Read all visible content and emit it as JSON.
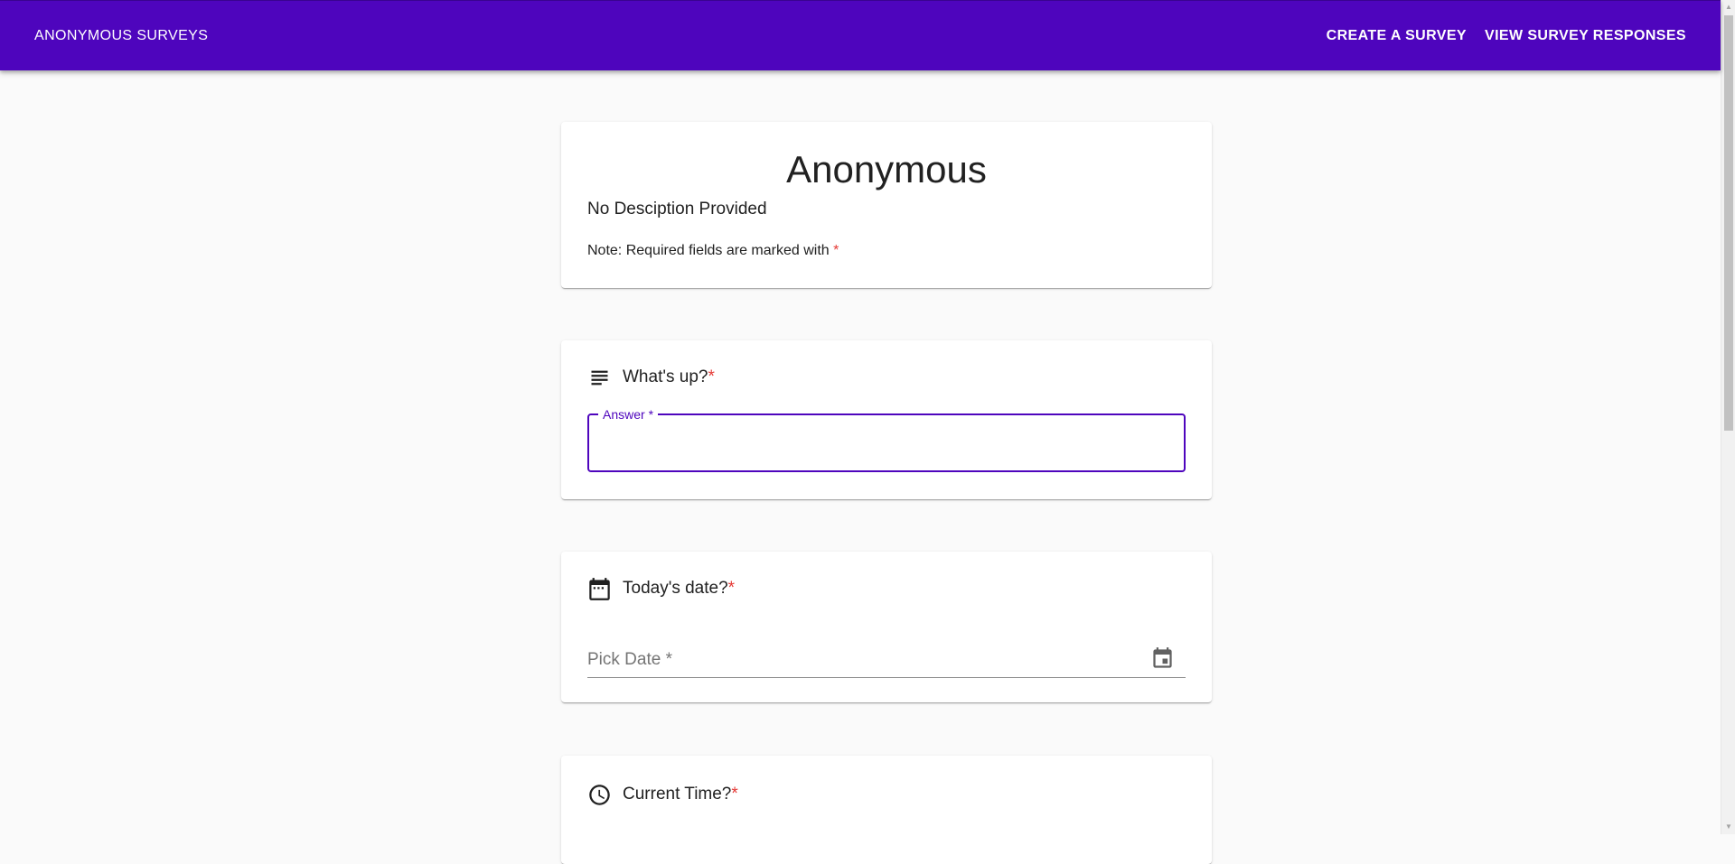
{
  "appbar": {
    "brand": "ANONYMOUS SURVEYS",
    "nav": {
      "create": "CREATE A SURVEY",
      "view": "VIEW SURVEY RESPONSES"
    },
    "color": "#4e05bd"
  },
  "survey": {
    "title": "Anonymous",
    "description": "No Desciption Provided",
    "note": "Note: Required fields are marked with",
    "required_marker": "*"
  },
  "questions": [
    {
      "icon": "short-text-icon",
      "title": "What's up?",
      "field_label": "Answer *",
      "value": ""
    },
    {
      "icon": "calendar-icon",
      "title": "Today's date?",
      "field_label": "Pick Date *",
      "button_icon": "event-icon"
    },
    {
      "icon": "clock-icon",
      "title": "Current Time?"
    }
  ],
  "colors": {
    "accent": "#4e05bd",
    "required": "#e53935",
    "background": "#fafafa"
  }
}
